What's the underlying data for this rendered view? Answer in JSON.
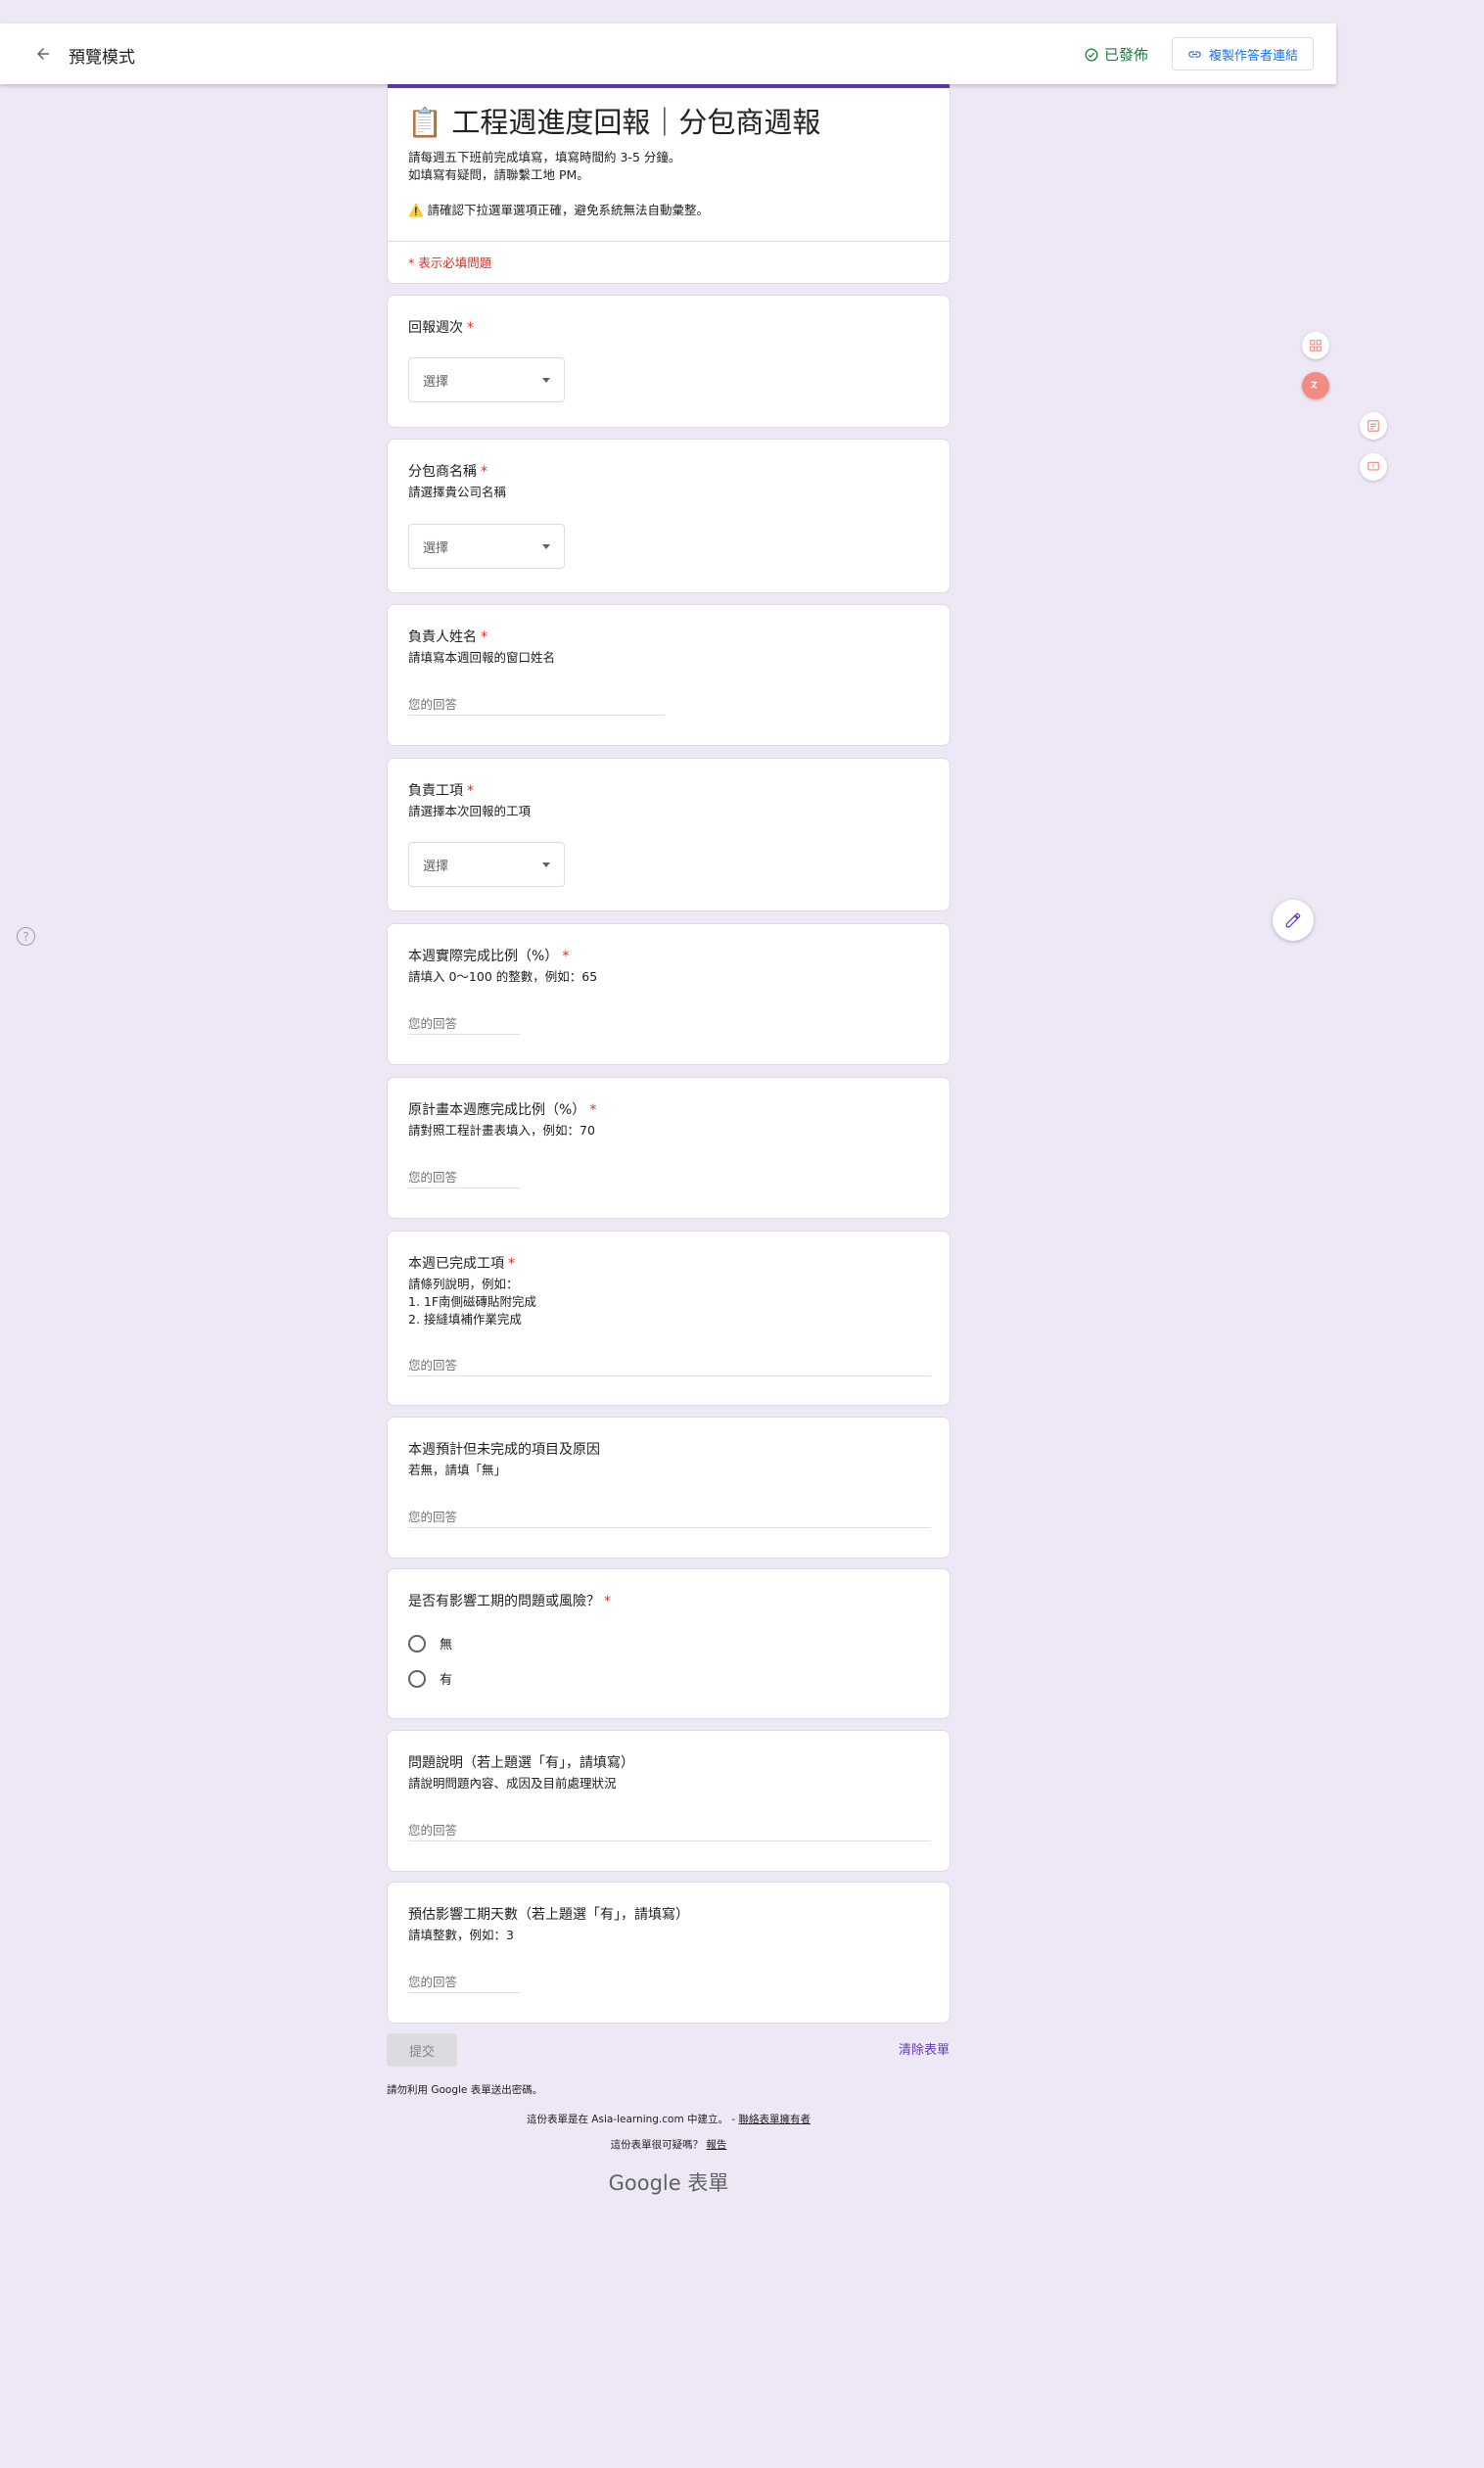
{
  "topbar": {
    "title": "預覽模式",
    "status": "已發佈",
    "copy_link_label": "複製作答者連結"
  },
  "form": {
    "title": "📋 工程週進度回報｜分包商週報",
    "description_lines": [
      "請每週五下班前完成填寫，填寫時間約 3-5 分鐘。",
      "如填寫有疑問，請聯繫工地 PM。",
      "⚠️ 請確認下拉選單選項正確，避免系統無法自動彙整。"
    ],
    "required_note": "* 表示必填問題"
  },
  "questions": [
    {
      "title": "回報週次",
      "required": "*",
      "type": "dropdown",
      "value": "選擇"
    },
    {
      "title": "分包商名稱",
      "required": "*",
      "help": "請選擇貴公司名稱",
      "type": "dropdown",
      "value": "選擇"
    },
    {
      "title": "負責人姓名",
      "required": "*",
      "help": "請填寫本週回報的窗口姓名",
      "type": "text",
      "placeholder": "您的回答"
    },
    {
      "title": "負責工項",
      "required": "*",
      "help": "請選擇本次回報的工項",
      "type": "dropdown",
      "value": "選擇"
    },
    {
      "title": "本週實際完成比例（%）",
      "required": "*",
      "help": "請填入 0～100 的整數，例如：65",
      "type": "text",
      "placeholder": "您的回答"
    },
    {
      "title": "原計畫本週應完成比例（%）",
      "required": "*",
      "help": "請對照工程計畫表填入，例如：70",
      "type": "text",
      "placeholder": "您的回答"
    },
    {
      "title": "本週已完成工項",
      "required": "*",
      "help": "請條列說明，例如：\n1. 1F南側磁磚貼附完成\n2. 接縫填補作業完成",
      "type": "text",
      "placeholder": "您的回答"
    },
    {
      "title": "本週預計但未完成的項目及原因",
      "help": "若無，請填「無」",
      "type": "text",
      "placeholder": "您的回答"
    },
    {
      "title": "是否有影響工期的問題或風險？",
      "required": "*",
      "type": "radio",
      "options": [
        "無",
        "有"
      ]
    },
    {
      "title": "問題說明（若上題選「有」，請填寫）",
      "help": "請說明問題內容、成因及目前處理狀況",
      "type": "text",
      "placeholder": "您的回答"
    },
    {
      "title": "預估影響工期天數（若上題選「有」，請填寫）",
      "help": "請填整數，例如：3",
      "type": "text",
      "placeholder": "您的回答"
    }
  ],
  "footer": {
    "submit_label": "提交",
    "clear_label": "清除表單",
    "password_note": "請勿利用 Google 表單送出密碼。",
    "created_prefix": "這份表單是在 Asia-learning.com 中建立。 - ",
    "created_link": "聯絡表單擁有者",
    "report_prefix": "這份表單很可疑嗎？ ",
    "report_link": "報告",
    "logo_text": "Google 表單"
  },
  "colors": {
    "accent": "#673ab7",
    "background": "#ede7f6",
    "required": "#d93025",
    "published": "#188038",
    "link": "#1a73e8"
  },
  "icons": {
    "back": "arrow-left-icon",
    "published": "check-circle-icon",
    "copy_link": "link-icon",
    "help": "help-circle-icon",
    "edit": "pencil-icon"
  }
}
